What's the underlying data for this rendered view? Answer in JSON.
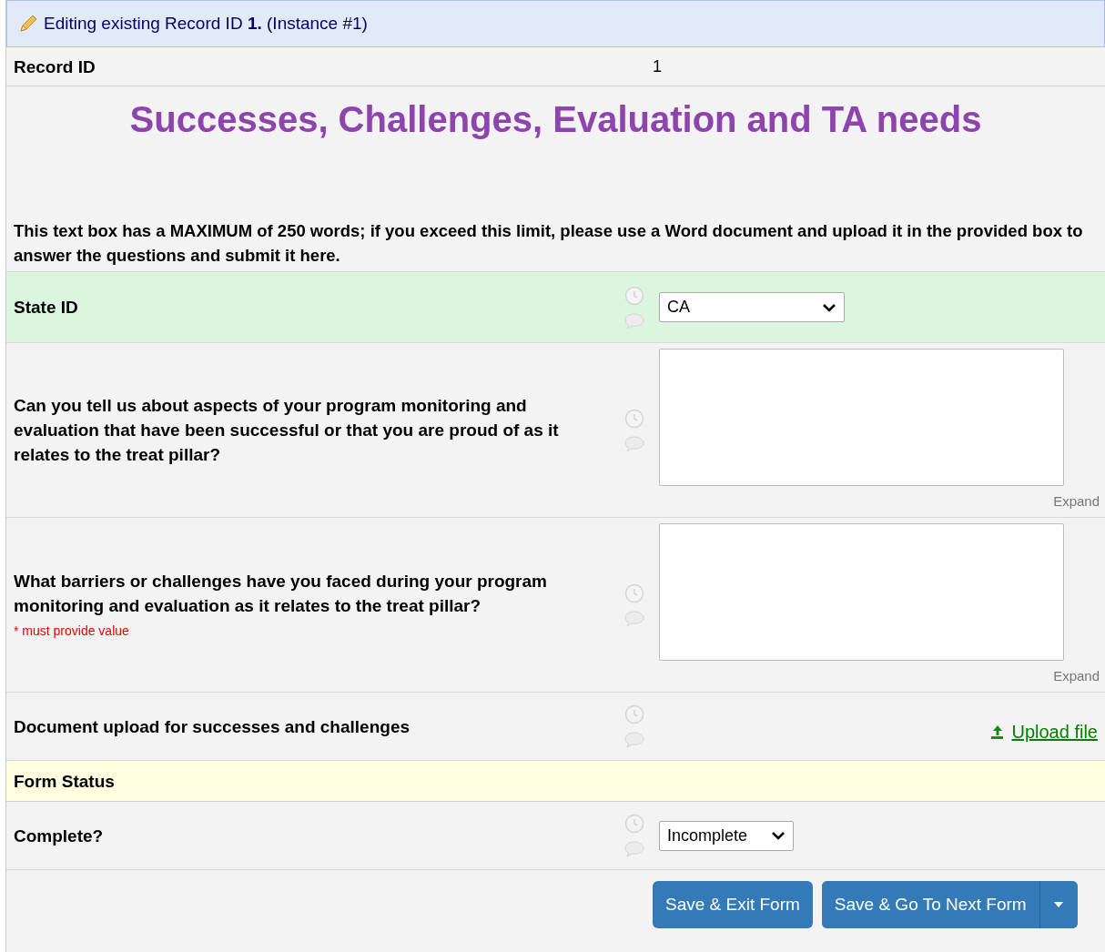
{
  "banner": {
    "text": "Editing existing Record ID **1.** (Instance #1)"
  },
  "record_id": {
    "label": "Record ID",
    "value": "1"
  },
  "title": "Successes, Challenges, Evaluation and TA needs",
  "description": "This text box has a MAXIMUM of 250 words; if you exceed this limit, please use a Word document and upload it in the provided box to answer the questions and submit it here.",
  "fields": [
    {
      "kind": "select",
      "label": "State ID",
      "value": "CA",
      "highlighted": true
    },
    {
      "kind": "textarea",
      "label": "Can you tell us about aspects of your program monitoring and evaluation that have been successful or that you are proud of as it relates to the treat pillar?",
      "expand": "Expand",
      "highlighted": false
    },
    {
      "kind": "textarea",
      "label": "What barriers or challenges have you faced during your program monitoring and evaluation as it relates to the treat pillar?",
      "required_note": "* must provide value",
      "expand": "Expand",
      "highlighted": false
    },
    {
      "kind": "upload",
      "label": "Document upload for successes and challenges",
      "link": "Upload file",
      "highlighted": false
    },
    {
      "kind": "section",
      "label": "Form Status"
    },
    {
      "kind": "select",
      "label": "Complete?",
      "value": "Incomplete",
      "highlighted": false
    }
  ],
  "buttons": [
    {
      "label": "Save & Exit Form",
      "dropdown": false
    },
    {
      "label": "Save & Go To Next Form",
      "dropdown": true
    }
  ]
}
